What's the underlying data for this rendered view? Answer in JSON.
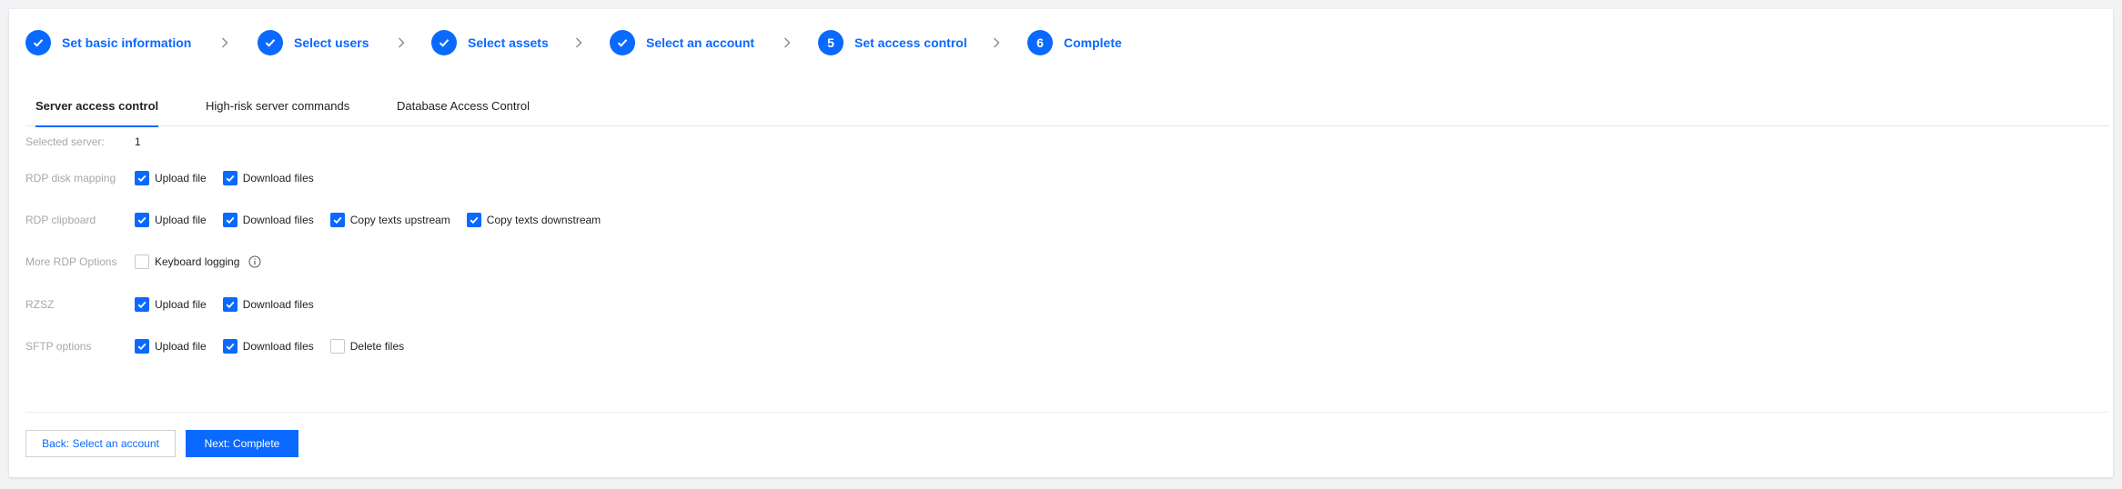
{
  "steps": [
    {
      "label": "Set basic information",
      "status": "done"
    },
    {
      "label": "Select users",
      "status": "done"
    },
    {
      "label": "Select assets",
      "status": "done"
    },
    {
      "label": "Select an account",
      "status": "done"
    },
    {
      "label": "Set access control",
      "status": "current",
      "number": "5"
    },
    {
      "label": "Complete",
      "status": "pending",
      "number": "6"
    }
  ],
  "tabs": [
    {
      "label": "Server access control",
      "active": true
    },
    {
      "label": "High-risk server commands",
      "active": false
    },
    {
      "label": "Database Access Control",
      "active": false
    }
  ],
  "form": {
    "selected_server": {
      "label": "Selected server:",
      "value": "1"
    },
    "rdp_disk_mapping": {
      "label": "RDP disk mapping",
      "options": [
        {
          "label": "Upload file",
          "checked": true
        },
        {
          "label": "Download files",
          "checked": true
        }
      ]
    },
    "rdp_clipboard": {
      "label": "RDP clipboard",
      "options": [
        {
          "label": "Upload file",
          "checked": true
        },
        {
          "label": "Download files",
          "checked": true
        },
        {
          "label": "Copy texts upstream",
          "checked": true
        },
        {
          "label": "Copy texts downstream",
          "checked": true
        }
      ]
    },
    "more_rdp_options": {
      "label": "More RDP Options",
      "options": [
        {
          "label": "Keyboard logging",
          "checked": false
        }
      ]
    },
    "rzsz": {
      "label": "RZSZ",
      "options": [
        {
          "label": "Upload file",
          "checked": true
        },
        {
          "label": "Download files",
          "checked": true
        }
      ]
    },
    "sftp_options": {
      "label": "SFTP options",
      "options": [
        {
          "label": "Upload file",
          "checked": true
        },
        {
          "label": "Download files",
          "checked": true
        },
        {
          "label": "Delete files",
          "checked": false
        }
      ]
    }
  },
  "buttons": {
    "back": "Back: Select an account",
    "next": "Next: Complete"
  },
  "colors": {
    "accent": "#0a69ff",
    "label_gray": "#a7a7a7",
    "background": "#f2f3f5"
  }
}
